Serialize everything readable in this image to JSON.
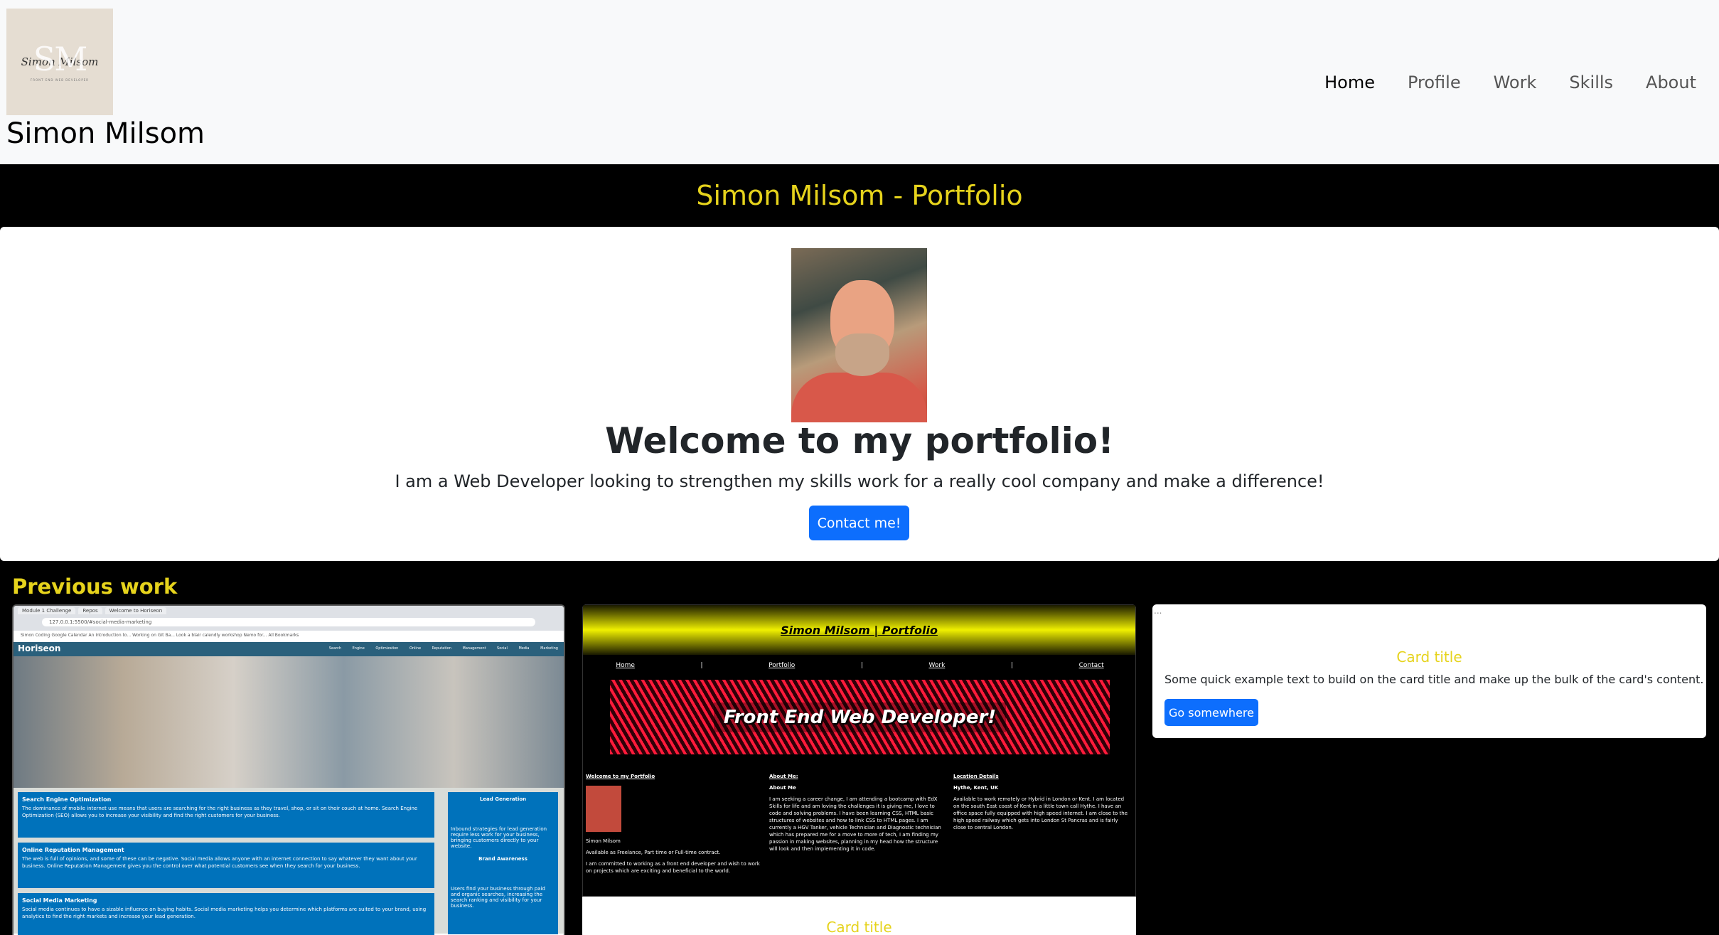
{
  "header": {
    "logo": {
      "monogram": "SM",
      "signature": "Simon Milsom",
      "tagline": "FRONT END WEB DEVELOPER"
    },
    "brand": "Simon Milsom",
    "nav": [
      "Home",
      "Profile",
      "Work",
      "Skills",
      "About"
    ],
    "active_nav": "Home"
  },
  "page_title": "Simon Milsom - Portfolio",
  "hero": {
    "heading": "Welcome to my portfolio!",
    "lead": "I am a Web Developer looking to strengthen my skills work for a really cool company and make a difference!",
    "button": "Contact me!"
  },
  "previous_work": {
    "title": "Previous work",
    "cards": [
      {
        "shot": {
          "tabs": [
            "Module 1 Challenge",
            "Repos",
            "Welcome to Horiseon"
          ],
          "url": "127.0.0.1:5500/#social-media-marketing",
          "bookmarks": "Simon   Coding   Google Calendar   An Introduction to...   Working on Git Ba...   Look a blair calendly   workshop Nemo for...   All Bookmarks",
          "site_name": "Horiseon",
          "nav_links": "Search Engine Optimization   Online Reputation Management   Social Media Marketing",
          "items": [
            {
              "heading": "Search Engine Optimization",
              "text": "The dominance of mobile internet use means that users are searching for the right business as they travel, shop, or sit on their couch at home. Search Engine Optimization (SEO) allows you to increase your visibility and find the right customers for your business."
            },
            {
              "heading": "Online Reputation Management",
              "text": "The web is full of opinions, and some of these can be negative. Social media allows anyone with an internet connection to say whatever they want about your business. Online Reputation Management gives you the control over what potential customers see when they search for your business."
            },
            {
              "heading": "Social Media Marketing",
              "text": "Social media continues to have a sizable influence on buying habits. Social media marketing helps you determine which platforms are suited to your brand, using analytics to find the right markets and increase your lead generation."
            }
          ],
          "aside": {
            "lead_heading": "Lead Generation",
            "lead_text": "Inbound strategies for lead generation require less work for your business, bringing customers directly to your website.",
            "brand_heading": "Brand Awareness",
            "brand_text": "Users find your business through paid and organic searches, increasing the search ranking and visibility for your business."
          }
        }
      },
      {
        "shot": {
          "site_title": "Simon Milsom | Portfolio",
          "nav": [
            "Home",
            "|",
            "Portfolio",
            "|",
            "Work",
            "|",
            "Contact"
          ],
          "banner": "Front End Web Developer!",
          "col1": {
            "heading": "Welcome to my Portfolio",
            "name": "Simon Milsom",
            "line1": "Available as Freelance, Part time or Full-time contract.",
            "line2": "I am committed to working as a front end developer and wish to work on projects which are exciting and beneficial to the world."
          },
          "col2": {
            "heading": "About Me:",
            "sub": "About Me",
            "text": "I am seeking a career change, I am attending a bootcamp with EdX Skills for life and am loving the challenges it is giving me, I love to code and solving problems. I have been learning CSS, HTML basic structures of websites and how to link CSS to HTML pages. I am currently a HGV Tanker, vehicle Technician and Diagnostic technician which has prepared me for a move to more of tech, I am finding my passion in making websites, planning in my head how the structure will look and then implementing it in code."
          },
          "col3": {
            "heading": "Location Details",
            "sub": "Hythe, Kent, UK",
            "text": "Available to work remotely or Hybrid in London or Kent. I am located on the south East coast of Kent in a little town call Hythe. I have an office space fully equipped with high speed internet. I am close to the high speed railway which gets into London St Pancras and is fairly close to central London."
          }
        },
        "title": "Card title"
      },
      {
        "image_alt": "...",
        "title": "Card title",
        "text": "Some quick example text to build on the card title and make up the bulk of the card's content.",
        "button": "Go somewhere"
      }
    ]
  },
  "colors": {
    "accent_yellow": "#e6d31c",
    "primary_blue": "#0d6efd",
    "header_bg": "#f8f9fa",
    "page_bg": "#000000"
  }
}
